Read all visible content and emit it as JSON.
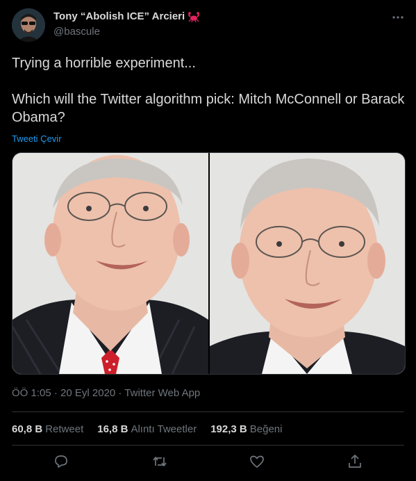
{
  "author": {
    "display_name": "Tony “Abolish ICE” Arcieri",
    "handle": "@bascule",
    "badge_icon": "crab-icon"
  },
  "tweet": {
    "text": "Trying a horrible experiment...\n\nWhich will the Twitter algorithm pick: Mitch McConnell or Barack Obama?",
    "translate_label": "Tweeti Çevir"
  },
  "meta": {
    "timestamp": "ÖÖ 1:05 · 20 Eyl 2020 · Twitter Web App"
  },
  "stats": {
    "retweets": {
      "count": "60,8 B",
      "label": "Retweet"
    },
    "quotes": {
      "count": "16,8 B",
      "label": "Alıntı Tweetler"
    },
    "likes": {
      "count": "192,3 B",
      "label": "Beğeni"
    }
  },
  "actions": [
    "reply-icon",
    "retweet-icon",
    "like-icon",
    "share-icon"
  ],
  "colors": {
    "background": "#000000",
    "text": "#d9d9d9",
    "muted": "#6e767d",
    "link": "#1d9bf0",
    "divider": "#2f3336"
  }
}
